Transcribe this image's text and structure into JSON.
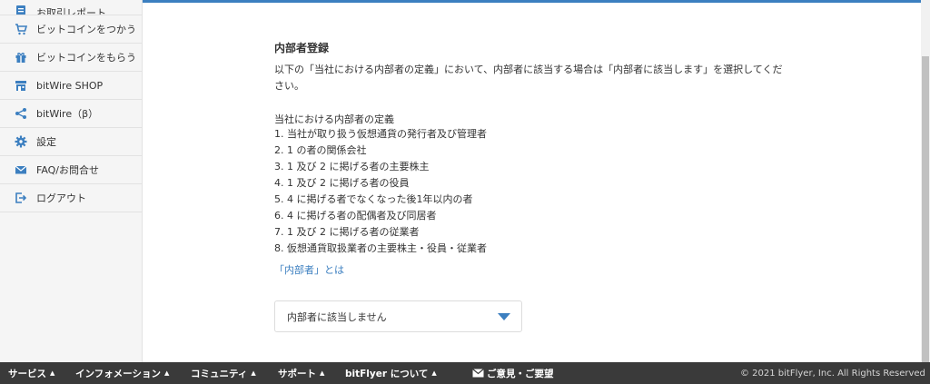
{
  "sidebar": {
    "items": [
      {
        "label": "お取引レポート",
        "icon": "report-icon"
      },
      {
        "label": "ビットコインをつかう",
        "icon": "cart-icon"
      },
      {
        "label": "ビットコインをもらう",
        "icon": "gift-icon"
      },
      {
        "label": "bitWire SHOP",
        "icon": "shop-icon"
      },
      {
        "label": "bitWire（β）",
        "icon": "share-icon"
      },
      {
        "label": "設定",
        "icon": "gear-icon"
      },
      {
        "label": "FAQ/お問合せ",
        "icon": "mail-icon"
      },
      {
        "label": "ログアウト",
        "icon": "logout-icon"
      }
    ]
  },
  "main": {
    "title": "内部者登録",
    "description": "以下の「当社における内部者の定義」において、内部者に該当する場合は「内部者に該当します」を選択してください。",
    "definition_title": "当社における内部者の定義",
    "definitions": [
      "1.  当社が取り扱う仮想通貨の発行者及び管理者",
      "2.  1 の者の関係会社",
      "3.  1 及び 2 に掲げる者の主要株主",
      "4.  1 及び 2 に掲げる者の役員",
      "5.  4 に掲げる者でなくなった後1年以内の者",
      "6.  4 に掲げる者の配偶者及び同居者",
      "7.  1 及び 2 に掲げる者の従業者",
      "8.  仮想通貨取扱業者の主要株主・役員・従業者"
    ],
    "insider_link": "「内部者」とは",
    "select_value": "内部者に該当しません"
  },
  "footer": {
    "nav": [
      {
        "label": "サービス"
      },
      {
        "label": "インフォメーション"
      },
      {
        "label": "コミュニティ"
      },
      {
        "label": "サポート"
      },
      {
        "label": "bitFlyer について"
      }
    ],
    "feedback": "ご意見・ご要望",
    "copyright": "© 2021 bitFlyer, Inc. All Rights Reserved"
  },
  "colors": {
    "accent": "#3c7fc0",
    "footer_bg": "#3a3a3a",
    "sidebar_bg": "#f5f5f5"
  }
}
